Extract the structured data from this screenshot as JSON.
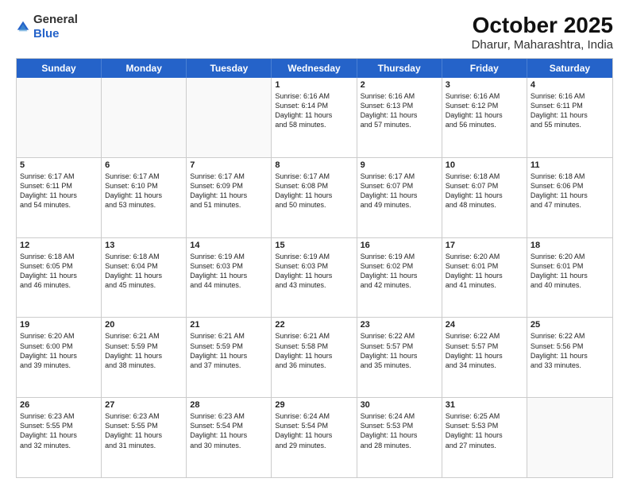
{
  "header": {
    "logo_line1": "General",
    "logo_line2": "Blue",
    "title": "October 2025",
    "subtitle": "Dharur, Maharashtra, India"
  },
  "weekdays": [
    "Sunday",
    "Monday",
    "Tuesday",
    "Wednesday",
    "Thursday",
    "Friday",
    "Saturday"
  ],
  "weeks": [
    [
      {
        "day": "",
        "info": ""
      },
      {
        "day": "",
        "info": ""
      },
      {
        "day": "",
        "info": ""
      },
      {
        "day": "1",
        "info": "Sunrise: 6:16 AM\nSunset: 6:14 PM\nDaylight: 11 hours\nand 58 minutes."
      },
      {
        "day": "2",
        "info": "Sunrise: 6:16 AM\nSunset: 6:13 PM\nDaylight: 11 hours\nand 57 minutes."
      },
      {
        "day": "3",
        "info": "Sunrise: 6:16 AM\nSunset: 6:12 PM\nDaylight: 11 hours\nand 56 minutes."
      },
      {
        "day": "4",
        "info": "Sunrise: 6:16 AM\nSunset: 6:11 PM\nDaylight: 11 hours\nand 55 minutes."
      }
    ],
    [
      {
        "day": "5",
        "info": "Sunrise: 6:17 AM\nSunset: 6:11 PM\nDaylight: 11 hours\nand 54 minutes."
      },
      {
        "day": "6",
        "info": "Sunrise: 6:17 AM\nSunset: 6:10 PM\nDaylight: 11 hours\nand 53 minutes."
      },
      {
        "day": "7",
        "info": "Sunrise: 6:17 AM\nSunset: 6:09 PM\nDaylight: 11 hours\nand 51 minutes."
      },
      {
        "day": "8",
        "info": "Sunrise: 6:17 AM\nSunset: 6:08 PM\nDaylight: 11 hours\nand 50 minutes."
      },
      {
        "day": "9",
        "info": "Sunrise: 6:17 AM\nSunset: 6:07 PM\nDaylight: 11 hours\nand 49 minutes."
      },
      {
        "day": "10",
        "info": "Sunrise: 6:18 AM\nSunset: 6:07 PM\nDaylight: 11 hours\nand 48 minutes."
      },
      {
        "day": "11",
        "info": "Sunrise: 6:18 AM\nSunset: 6:06 PM\nDaylight: 11 hours\nand 47 minutes."
      }
    ],
    [
      {
        "day": "12",
        "info": "Sunrise: 6:18 AM\nSunset: 6:05 PM\nDaylight: 11 hours\nand 46 minutes."
      },
      {
        "day": "13",
        "info": "Sunrise: 6:18 AM\nSunset: 6:04 PM\nDaylight: 11 hours\nand 45 minutes."
      },
      {
        "day": "14",
        "info": "Sunrise: 6:19 AM\nSunset: 6:03 PM\nDaylight: 11 hours\nand 44 minutes."
      },
      {
        "day": "15",
        "info": "Sunrise: 6:19 AM\nSunset: 6:03 PM\nDaylight: 11 hours\nand 43 minutes."
      },
      {
        "day": "16",
        "info": "Sunrise: 6:19 AM\nSunset: 6:02 PM\nDaylight: 11 hours\nand 42 minutes."
      },
      {
        "day": "17",
        "info": "Sunrise: 6:20 AM\nSunset: 6:01 PM\nDaylight: 11 hours\nand 41 minutes."
      },
      {
        "day": "18",
        "info": "Sunrise: 6:20 AM\nSunset: 6:01 PM\nDaylight: 11 hours\nand 40 minutes."
      }
    ],
    [
      {
        "day": "19",
        "info": "Sunrise: 6:20 AM\nSunset: 6:00 PM\nDaylight: 11 hours\nand 39 minutes."
      },
      {
        "day": "20",
        "info": "Sunrise: 6:21 AM\nSunset: 5:59 PM\nDaylight: 11 hours\nand 38 minutes."
      },
      {
        "day": "21",
        "info": "Sunrise: 6:21 AM\nSunset: 5:59 PM\nDaylight: 11 hours\nand 37 minutes."
      },
      {
        "day": "22",
        "info": "Sunrise: 6:21 AM\nSunset: 5:58 PM\nDaylight: 11 hours\nand 36 minutes."
      },
      {
        "day": "23",
        "info": "Sunrise: 6:22 AM\nSunset: 5:57 PM\nDaylight: 11 hours\nand 35 minutes."
      },
      {
        "day": "24",
        "info": "Sunrise: 6:22 AM\nSunset: 5:57 PM\nDaylight: 11 hours\nand 34 minutes."
      },
      {
        "day": "25",
        "info": "Sunrise: 6:22 AM\nSunset: 5:56 PM\nDaylight: 11 hours\nand 33 minutes."
      }
    ],
    [
      {
        "day": "26",
        "info": "Sunrise: 6:23 AM\nSunset: 5:55 PM\nDaylight: 11 hours\nand 32 minutes."
      },
      {
        "day": "27",
        "info": "Sunrise: 6:23 AM\nSunset: 5:55 PM\nDaylight: 11 hours\nand 31 minutes."
      },
      {
        "day": "28",
        "info": "Sunrise: 6:23 AM\nSunset: 5:54 PM\nDaylight: 11 hours\nand 30 minutes."
      },
      {
        "day": "29",
        "info": "Sunrise: 6:24 AM\nSunset: 5:54 PM\nDaylight: 11 hours\nand 29 minutes."
      },
      {
        "day": "30",
        "info": "Sunrise: 6:24 AM\nSunset: 5:53 PM\nDaylight: 11 hours\nand 28 minutes."
      },
      {
        "day": "31",
        "info": "Sunrise: 6:25 AM\nSunset: 5:53 PM\nDaylight: 11 hours\nand 27 minutes."
      },
      {
        "day": "",
        "info": ""
      }
    ]
  ]
}
